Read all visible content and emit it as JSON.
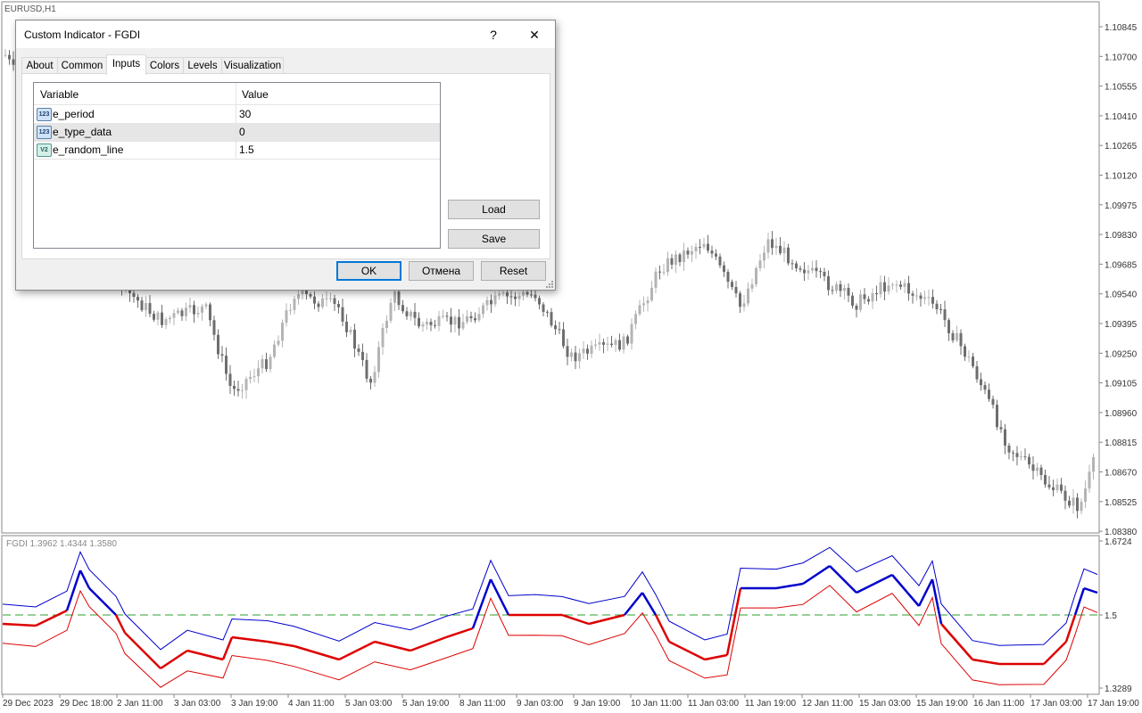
{
  "chart": {
    "symbol": "EURUSD,H1",
    "price_labels": [
      "1.10845",
      "1.10700",
      "1.10555",
      "1.10410",
      "1.10265",
      "1.10120",
      "1.09975",
      "1.09830",
      "1.09685",
      "1.09540",
      "1.09395",
      "1.09250",
      "1.09105",
      "1.08960",
      "1.08815",
      "1.08670",
      "1.08525",
      "1.08380"
    ],
    "indicator_label": "FGDI 1.3962 1.4344 1.3580",
    "indicator_scale": [
      "1.6724",
      "1.5",
      "1.3289"
    ],
    "time_labels": [
      "29 Dec 2023",
      "29 Dec 18:00",
      "2 Jan 11:00",
      "3 Jan 03:00",
      "3 Jan 19:00",
      "4 Jan 11:00",
      "5 Jan 03:00",
      "5 Jan 19:00",
      "8 Jan 11:00",
      "9 Jan 03:00",
      "9 Jan 19:00",
      "10 Jan 11:00",
      "11 Jan 03:00",
      "11 Jan 19:00",
      "12 Jan 11:00",
      "15 Jan 03:00",
      "15 Jan 19:00",
      "16 Jan 11:00",
      "17 Jan 03:00",
      "17 Jan 19:00"
    ],
    "colors": {
      "bull": "#b4b4b4",
      "bear": "#6e6e6e",
      "mid": "#0000cc",
      "low": "#dd0000",
      "level": "#2ca02c"
    }
  },
  "dialog": {
    "title": "Custom Indicator - FGDI",
    "help": "?",
    "close": "✕",
    "tabs": [
      {
        "label": "About"
      },
      {
        "label": "Common"
      },
      {
        "label": "Inputs"
      },
      {
        "label": "Colors"
      },
      {
        "label": "Levels"
      },
      {
        "label": "Visualization"
      }
    ],
    "active_tab": "Inputs",
    "grid": {
      "col_variable": "Variable",
      "col_value": "Value",
      "rows": [
        {
          "icon": "int-icon",
          "icon_text": "123",
          "name": "e_period",
          "value": "30"
        },
        {
          "icon": "int-icon",
          "icon_text": "123",
          "name": "e_type_data",
          "value": "0"
        },
        {
          "icon": "double-icon",
          "icon_text": "V2",
          "name": "e_random_line",
          "value": "1.5"
        }
      ]
    },
    "load": "Load",
    "save": "Save",
    "ok": "OK",
    "cancel": "Отмена",
    "reset": "Reset"
  }
}
